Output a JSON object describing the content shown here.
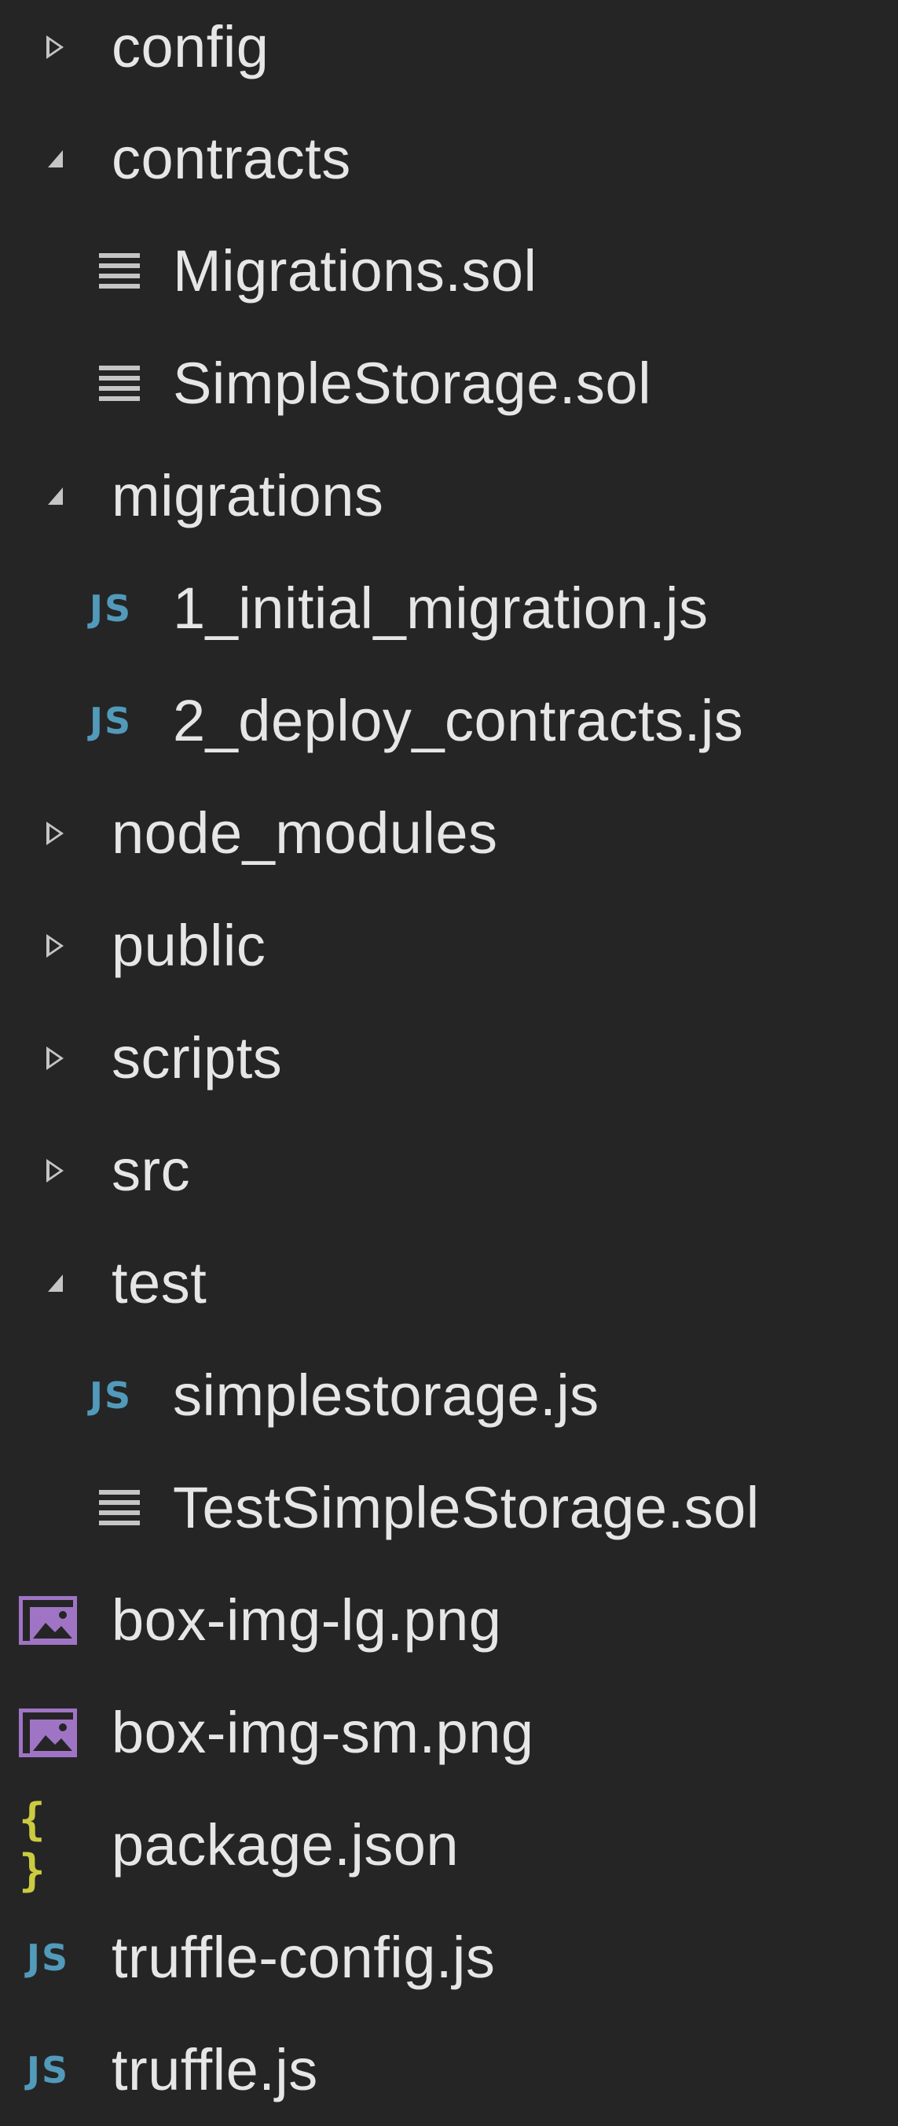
{
  "explorer": {
    "items": [
      {
        "label": "config",
        "kind": "folder",
        "expanded": false,
        "icon": "chevron-right-icon"
      },
      {
        "label": "contracts",
        "kind": "folder",
        "expanded": true,
        "icon": "chevron-down-icon"
      },
      {
        "label": "Migrations.sol",
        "kind": "file",
        "icon": "text-file-icon"
      },
      {
        "label": "SimpleStorage.sol",
        "kind": "file",
        "icon": "text-file-icon"
      },
      {
        "label": "migrations",
        "kind": "folder",
        "expanded": true,
        "icon": "chevron-down-icon"
      },
      {
        "label": "1_initial_migration.js",
        "kind": "file",
        "icon": "js-file-icon"
      },
      {
        "label": "2_deploy_contracts.js",
        "kind": "file",
        "icon": "js-file-icon"
      },
      {
        "label": "node_modules",
        "kind": "folder",
        "expanded": false,
        "icon": "chevron-right-icon"
      },
      {
        "label": "public",
        "kind": "folder",
        "expanded": false,
        "icon": "chevron-right-icon"
      },
      {
        "label": "scripts",
        "kind": "folder",
        "expanded": false,
        "icon": "chevron-right-icon"
      },
      {
        "label": "src",
        "kind": "folder",
        "expanded": false,
        "icon": "chevron-right-icon"
      },
      {
        "label": "test",
        "kind": "folder",
        "expanded": true,
        "icon": "chevron-down-icon"
      },
      {
        "label": "simplestorage.js",
        "kind": "file",
        "icon": "js-file-icon"
      },
      {
        "label": "TestSimpleStorage.sol",
        "kind": "file",
        "icon": "text-file-icon"
      },
      {
        "label": "box-img-lg.png",
        "kind": "file",
        "icon": "image-file-icon"
      },
      {
        "label": "box-img-sm.png",
        "kind": "file",
        "icon": "image-file-icon"
      },
      {
        "label": "package.json",
        "kind": "file",
        "icon": "json-file-icon"
      },
      {
        "label": "truffle-config.js",
        "kind": "file",
        "icon": "js-file-icon"
      },
      {
        "label": "truffle.js",
        "kind": "file",
        "icon": "js-file-icon"
      }
    ],
    "icon_glyphs": {
      "js": "JS",
      "json": "{ }"
    }
  },
  "colors": {
    "background": "#252526",
    "text": "#e6e6e6",
    "chevron": "#c5c5c5",
    "js_icon": "#519aba",
    "json_icon": "#cbcb41",
    "image_icon": "#a074c4"
  }
}
